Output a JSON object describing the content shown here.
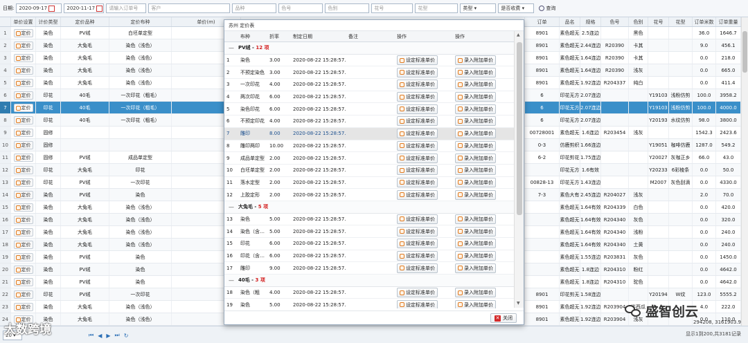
{
  "toolbar": {
    "date_label": "日期:",
    "date_from": "2020-09-17",
    "date_to": "2020-11-17",
    "order_placeholder": "请输入订单号",
    "customer_placeholder": "客户",
    "product_placeholder": "品种",
    "color_no_placeholder": "色号",
    "color_other_placeholder": "色别",
    "pattern_no_placeholder": "花号",
    "pattern_placeholder": "花型",
    "type_label": "类型",
    "charge_label": "是否收费",
    "search_label": "查询"
  },
  "grid": {
    "headers": [
      "单价设置",
      "计价类型",
      "定价品种",
      "定价布种",
      "单价(m)",
      "",
      "订单",
      "品名",
      "规格",
      "色号",
      "色别",
      "花号",
      "花型",
      "订单米数",
      "订单重量"
    ],
    "price_btn": "定价",
    "rows": [
      {
        "n": "1",
        "type": "染色",
        "kind": "PV绒",
        "cloth": "白坯单定型",
        "order": "8901",
        "name": "素色超无",
        "spec": "2.5连边",
        "color": "",
        "ctype": "黑色",
        "pat": "",
        "ptype": "",
        "m": "36.0",
        "w": "1646.7"
      },
      {
        "n": "2",
        "type": "染色",
        "kind": "大兔毛",
        "cloth": "染色（浅色）",
        "order": "8901",
        "name": "素色超无",
        "spec": "2.44连边",
        "color": "R20390",
        "ctype": "卡其",
        "pat": "",
        "ptype": "",
        "m": "9.0",
        "w": "456.1"
      },
      {
        "n": "3",
        "type": "染色",
        "kind": "大兔毛",
        "cloth": "染色（浅色）",
        "order": "8901",
        "name": "素色超无",
        "spec": "1.64连边",
        "color": "R20390",
        "ctype": "卡其",
        "pat": "",
        "ptype": "",
        "m": "0.0",
        "w": "218.0"
      },
      {
        "n": "4",
        "type": "染色",
        "kind": "大兔毛",
        "cloth": "染色（浅色）",
        "order": "8901",
        "name": "素色超无",
        "spec": "1.64连边",
        "color": "R20390",
        "ctype": "浅灰",
        "pat": "",
        "ptype": "",
        "m": "0.0",
        "w": "665.0"
      },
      {
        "n": "5",
        "type": "染色",
        "kind": "大兔毛",
        "cloth": "染色（浅色）",
        "order": "8901",
        "name": "素色超无",
        "spec": "1.92连边",
        "color": "R204337",
        "ctype": "纯白",
        "pat": "",
        "ptype": "",
        "m": "0.0",
        "w": "411.4"
      },
      {
        "n": "6",
        "type": "印花",
        "kind": "40毛",
        "cloth": "一次印花（粗毛）",
        "order": "6",
        "name": "印花无方",
        "spec": "2.07连边",
        "color": "",
        "ctype": "",
        "pat": "Y19103",
        "ptype": "浅粉仿剪",
        "m": "100.0",
        "w": "3958.2"
      },
      {
        "n": "7",
        "type": "印花",
        "kind": "40毛",
        "cloth": "一次印花（粗毛）",
        "order": "6",
        "name": "印花无方",
        "spec": "2.07连边",
        "color": "",
        "ctype": "",
        "pat": "Y19103",
        "ptype": "浅粉仿剪",
        "m": "100.0",
        "w": "4000.0"
      },
      {
        "n": "8",
        "type": "印花",
        "kind": "40毛",
        "cloth": "一次印花（粗毛）",
        "order": "6",
        "name": "印花无方",
        "spec": "2.07连边",
        "color": "",
        "ctype": "",
        "pat": "Y20193",
        "ptype": "水纹仿剪",
        "m": "98.0",
        "w": "3800.0"
      },
      {
        "n": "9",
        "type": "固修",
        "kind": "",
        "cloth": "",
        "order": "00728001",
        "name": "素色超无",
        "spec": "1.6连边",
        "color": "R203454",
        "ctype": "浅灰",
        "pat": "",
        "ptype": "",
        "m": "1542.3",
        "w": "2423.6"
      },
      {
        "n": "10",
        "type": "固修",
        "kind": "",
        "cloth": "",
        "order": "0-3",
        "name": "仿鹿剪织",
        "spec": "1.66连边",
        "color": "",
        "ctype": "",
        "pat": "Y19051",
        "ptype": "咖啡仿鹿",
        "m": "1287.0",
        "w": "549.2"
      },
      {
        "n": "11",
        "type": "固修",
        "kind": "PV绒",
        "cloth": "成品单定型",
        "order": "6-2",
        "name": "印花剪花",
        "spec": "1.75连边",
        "color": "",
        "ctype": "",
        "pat": "Y20027",
        "ptype": "灰咖正乡",
        "m": "66.0",
        "w": "43.0"
      },
      {
        "n": "12",
        "type": "印花",
        "kind": "大兔毛",
        "cloth": "印花",
        "order": "",
        "name": "印花无方",
        "spec": "1.6有效",
        "color": "",
        "ctype": "",
        "pat": "Y20233",
        "ptype": "6彩棱条",
        "m": "0.0",
        "w": "50.0"
      },
      {
        "n": "13",
        "type": "印花",
        "kind": "PV绒",
        "cloth": "一次印花",
        "order": "00828-13",
        "name": "印花无方",
        "spec": "1.43连边",
        "color": "",
        "ctype": "",
        "pat": "M2007",
        "ptype": "灰色刮滴",
        "m": "0.0",
        "w": "4330.0"
      },
      {
        "n": "14",
        "type": "染色",
        "kind": "PV绒",
        "cloth": "染色",
        "order": "7-3",
        "name": "素色大有",
        "spec": "2.45连边",
        "color": "R204027",
        "ctype": "浅灰",
        "pat": "",
        "ptype": "",
        "m": "2.0",
        "w": "70.0"
      },
      {
        "n": "15",
        "type": "染色",
        "kind": "大兔毛",
        "cloth": "染色（浅色）",
        "order": "",
        "name": "素色超无",
        "spec": "1.64有效",
        "color": "R204339",
        "ctype": "白色",
        "pat": "",
        "ptype": "",
        "m": "0.0",
        "w": "420.0"
      },
      {
        "n": "16",
        "type": "染色",
        "kind": "大兔毛",
        "cloth": "染色（浅色）",
        "order": "",
        "name": "素色超无",
        "spec": "1.64有效",
        "color": "R204340",
        "ctype": "灰色",
        "pat": "",
        "ptype": "",
        "m": "0.0",
        "w": "320.0"
      },
      {
        "n": "17",
        "type": "染色",
        "kind": "大兔毛",
        "cloth": "染色（浅色）",
        "order": "",
        "name": "素色超无",
        "spec": "1.64有效",
        "color": "R204340",
        "ctype": "浅粉",
        "pat": "",
        "ptype": "",
        "m": "0.0",
        "w": "240.0"
      },
      {
        "n": "18",
        "type": "染色",
        "kind": "大兔毛",
        "cloth": "染色（浅色）",
        "order": "",
        "name": "素色超无",
        "spec": "1.64有效",
        "color": "R204340",
        "ctype": "土黄",
        "pat": "",
        "ptype": "",
        "m": "0.0",
        "w": "240.0"
      },
      {
        "n": "19",
        "type": "染色",
        "kind": "PV绒",
        "cloth": "染色",
        "order": "",
        "name": "素色超无",
        "spec": "1.55连边",
        "color": "R203831",
        "ctype": "灰色",
        "pat": "",
        "ptype": "",
        "m": "0.0",
        "w": "1450.0"
      },
      {
        "n": "20",
        "type": "染色",
        "kind": "PV绒",
        "cloth": "染色",
        "order": "",
        "name": "素色超无",
        "spec": "1.8连边",
        "color": "R204310",
        "ctype": "粉红",
        "pat": "",
        "ptype": "",
        "m": "0.0",
        "w": "4642.0"
      },
      {
        "n": "21",
        "type": "染色",
        "kind": "PV绒",
        "cloth": "染色",
        "order": "",
        "name": "素色超无",
        "spec": "1.8连边",
        "color": "R204310",
        "ctype": "驼色",
        "pat": "",
        "ptype": "",
        "m": "0.0",
        "w": "4642.0"
      },
      {
        "n": "22",
        "type": "印花",
        "kind": "PV绒",
        "cloth": "一次印花",
        "order": "8901",
        "name": "印花剪无",
        "spec": "1.58连边",
        "color": "",
        "ctype": "",
        "pat": "Y20194",
        "ptype": "W纹",
        "m": "123.0",
        "w": "5555.2"
      },
      {
        "n": "23",
        "type": "染色",
        "kind": "大兔毛",
        "cloth": "染色（浅色）",
        "order": "8901",
        "name": "素色超无",
        "spec": "1.92连边",
        "color": "R203904",
        "ctype": "半西瓜",
        "pat": "",
        "ptype": "",
        "m": "4.0",
        "w": "222.0"
      },
      {
        "n": "24",
        "type": "染色",
        "kind": "大兔毛",
        "cloth": "染色（浅色）",
        "order": "8901",
        "name": "素色超无",
        "spec": "1.92连边",
        "color": "R203904",
        "ctype": "浅灰",
        "pat": "",
        "ptype": "",
        "m": "0.0",
        "w": "110.0"
      }
    ]
  },
  "footer": {
    "page_size": "20",
    "totals": "294208, 3161903.9",
    "summary": "显示1到200,共3181记录"
  },
  "modal": {
    "title": "苏州           定价表",
    "headers": [
      "",
      "布种",
      "折率",
      "制定日期",
      "备注",
      "操作",
      "操作"
    ],
    "btn_std": "设定标准单价",
    "btn_extra": "录入附加单价",
    "close_label": "关闭",
    "groups": [
      {
        "name": "PV绒",
        "count": "12 项",
        "rows": [
          {
            "n": "1",
            "cloth": "染色",
            "rate": "3.00",
            "date": "2020-08-22 15:28:57.1"
          },
          {
            "n": "2",
            "cloth": "不预定染色",
            "rate": "3.00",
            "date": "2020-08-22 15:28:57.1"
          },
          {
            "n": "3",
            "cloth": "一次印花",
            "rate": "4.00",
            "date": "2020-08-22 15:28:57.1"
          },
          {
            "n": "4",
            "cloth": "两次印花",
            "rate": "6.00",
            "date": "2020-08-22 15:28:57.1"
          },
          {
            "n": "5",
            "cloth": "染色印花",
            "rate": "6.00",
            "date": "2020-08-22 15:28:57.1"
          },
          {
            "n": "6",
            "cloth": "不预定印花",
            "rate": "4.00",
            "date": "2020-08-22 15:28:57.1"
          },
          {
            "n": "7",
            "cloth": "雕印",
            "rate": "8.00",
            "date": "2020-08-22 15:28:57.1"
          },
          {
            "n": "8",
            "cloth": "雕印两印",
            "rate": "10.00",
            "date": "2020-08-22 15:28:57.1"
          },
          {
            "n": "9",
            "cloth": "成品单定型",
            "rate": "2.00",
            "date": "2020-08-22 15:28:57.1"
          },
          {
            "n": "10",
            "cloth": "白坯单定型",
            "rate": "2.00",
            "date": "2020-08-22 15:28:57.1"
          },
          {
            "n": "11",
            "cloth": "落水定型",
            "rate": "2.00",
            "date": "2020-08-22 15:28:57.1"
          },
          {
            "n": "12",
            "cloth": "上胶定形",
            "rate": "2.00",
            "date": "2020-08-22 15:28:57.1"
          }
        ]
      },
      {
        "name": "大兔毛",
        "count": "5 项",
        "rows": [
          {
            "n": "13",
            "cloth": "染色",
            "rate": "5.00",
            "date": "2020-08-22 15:28:57.1"
          },
          {
            "n": "14",
            "cloth": "染色（含…",
            "rate": "5.00",
            "date": "2020-08-22 15:28:57.1"
          },
          {
            "n": "15",
            "cloth": "印花",
            "rate": "6.00",
            "date": "2020-08-22 15:28:57.1"
          },
          {
            "n": "16",
            "cloth": "印花（含…",
            "rate": "6.00",
            "date": "2020-08-22 15:28:57.1"
          },
          {
            "n": "17",
            "cloth": "雕印",
            "rate": "9.00",
            "date": "2020-08-22 15:28:57.1"
          }
        ]
      },
      {
        "name": "40毛",
        "count": "3 项",
        "rows": [
          {
            "n": "18",
            "cloth": "染色（粗",
            "rate": "4.00",
            "date": "2020-08-22 15:28:57.1"
          },
          {
            "n": "19",
            "cloth": "染色",
            "rate": "5.00",
            "date": "2020-08-22 15:28:57.1"
          },
          {
            "n": "20",
            "cloth": "一次印花",
            "rate": "5.00",
            "date": "2020-09-10 16:35:32.8"
          }
        ]
      }
    ]
  },
  "watermark": {
    "left": "大数跨境",
    "right": "盛智创云"
  }
}
